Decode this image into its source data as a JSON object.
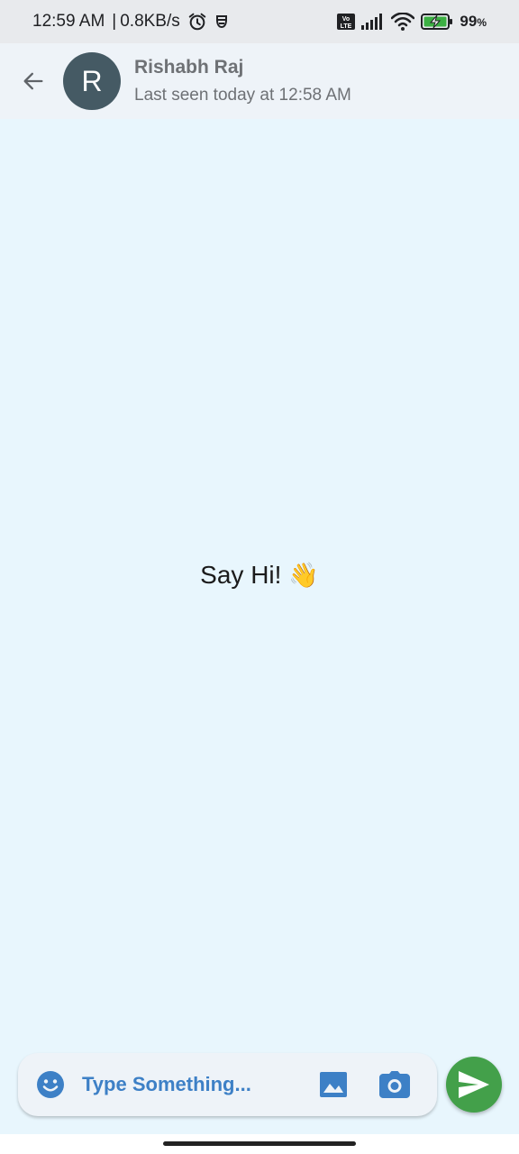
{
  "status_bar": {
    "time": "12:59 AM",
    "separator": "|",
    "net_speed": "0.8KB/s",
    "battery_percent": "99",
    "battery_unit": "%",
    "volte_top": "Vo",
    "volte_bottom": "LTE",
    "icons": [
      "alarm-icon",
      "notification-icon",
      "volte-icon",
      "signal-icon",
      "wifi-icon",
      "battery-charging-icon"
    ]
  },
  "app_bar": {
    "avatar_initial": "R",
    "contact_name": "Rishabh Raj",
    "last_seen": "Last seen today at 12:58 AM"
  },
  "chat": {
    "empty_text": "Say Hi!",
    "empty_emoji": "👋"
  },
  "composer": {
    "placeholder": "Type Something...",
    "value": ""
  },
  "colors": {
    "status_bar_bg": "#e8eaed",
    "app_bar_bg": "#eef3f8",
    "chat_bg": "#e8f6fd",
    "accent_blue": "#3d80c6",
    "send_green": "#43a04a",
    "avatar_bg": "#455a64"
  }
}
